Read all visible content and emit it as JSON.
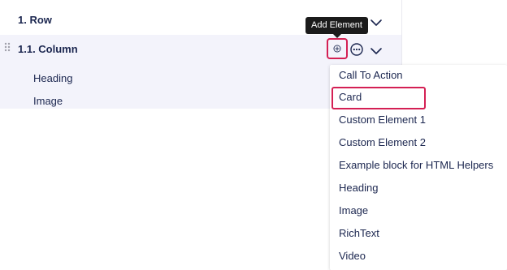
{
  "tree": {
    "row_label": "1. Row",
    "column_label": "1.1. Column",
    "children": [
      "Heading",
      "Image"
    ]
  },
  "tooltip": {
    "text": "Add Element"
  },
  "icons": {
    "drag": "drag-handle-icon",
    "add": "plus-circle-icon",
    "more": "ellipsis-circle-icon",
    "chevron": "chevron-down-icon"
  },
  "menu": {
    "items": [
      "Call To Action",
      "Card",
      "Custom Element 1",
      "Custom Element 2",
      "Example block for HTML Helpers",
      "Heading",
      "Image",
      "RichText",
      "Video"
    ],
    "selected": "Card"
  },
  "colors": {
    "highlight": "#d42054",
    "text": "#1b264f",
    "selected_row_bg": "#f3f3fb",
    "tooltip_bg": "#1b1b1b"
  }
}
